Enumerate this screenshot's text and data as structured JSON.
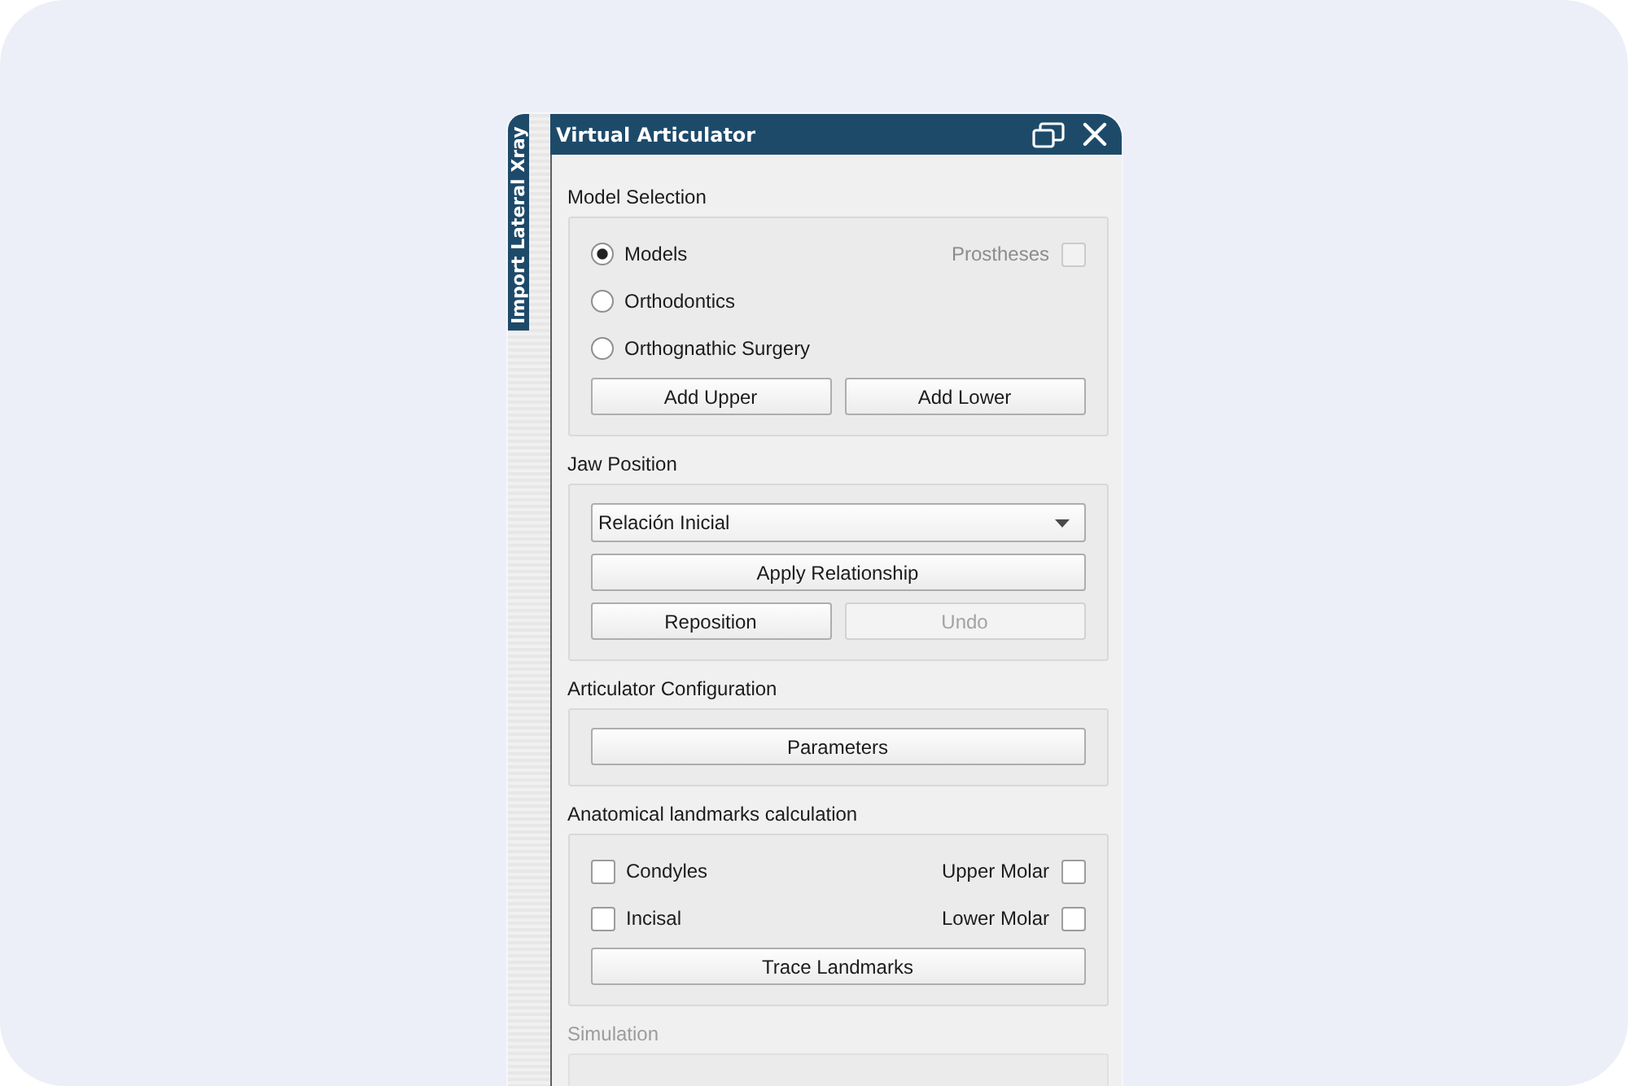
{
  "side_tabs": [
    {
      "label": "Import Lateral Xray",
      "selected": true
    }
  ],
  "window": {
    "title": "Virtual Articulator"
  },
  "sections": [
    {
      "title": "Model Selection",
      "disabled": false,
      "rows": [
        {
          "kind": "options",
          "left": {
            "kind": "radio",
            "label": "Models",
            "selected": true
          },
          "right": {
            "kind": "checkbox",
            "label": "Prostheses",
            "checked": false,
            "disabled": true
          }
        },
        {
          "kind": "options",
          "left": {
            "kind": "radio",
            "label": "Orthodontics",
            "selected": false
          }
        },
        {
          "kind": "options",
          "left": {
            "kind": "radio",
            "label": "Orthognathic Surgery",
            "selected": false
          }
        },
        {
          "kind": "buttons",
          "buttons": [
            {
              "label": "Add Upper",
              "disabled": false
            },
            {
              "label": "Add Lower",
              "disabled": false
            }
          ]
        }
      ]
    },
    {
      "title": "Jaw Position",
      "disabled": false,
      "rows": [
        {
          "kind": "dropdown",
          "value": "Relación Inicial"
        },
        {
          "kind": "buttons",
          "buttons": [
            {
              "label": "Apply Relationship",
              "disabled": false
            }
          ]
        },
        {
          "kind": "buttons",
          "buttons": [
            {
              "label": "Reposition",
              "disabled": false
            },
            {
              "label": "Undo",
              "disabled": true
            }
          ]
        }
      ]
    },
    {
      "title": "Articulator Configuration",
      "disabled": false,
      "rows": [
        {
          "kind": "buttons",
          "buttons": [
            {
              "label": "Parameters",
              "disabled": false
            }
          ]
        }
      ]
    },
    {
      "title": "Anatomical landmarks calculation",
      "disabled": false,
      "rows": [
        {
          "kind": "options",
          "left": {
            "kind": "checkbox",
            "label": "Condyles",
            "checked": false,
            "disabled": false
          },
          "right": {
            "kind": "checkbox",
            "label": "Upper Molar",
            "checked": false,
            "disabled": false
          }
        },
        {
          "kind": "options",
          "left": {
            "kind": "checkbox",
            "label": "Incisal",
            "checked": false,
            "disabled": false
          },
          "right": {
            "kind": "checkbox",
            "label": "Lower Molar",
            "checked": false,
            "disabled": false
          }
        },
        {
          "kind": "buttons",
          "buttons": [
            {
              "label": "Trace Landmarks",
              "disabled": false
            }
          ]
        }
      ]
    },
    {
      "title": "Simulation",
      "disabled": true
    }
  ]
}
